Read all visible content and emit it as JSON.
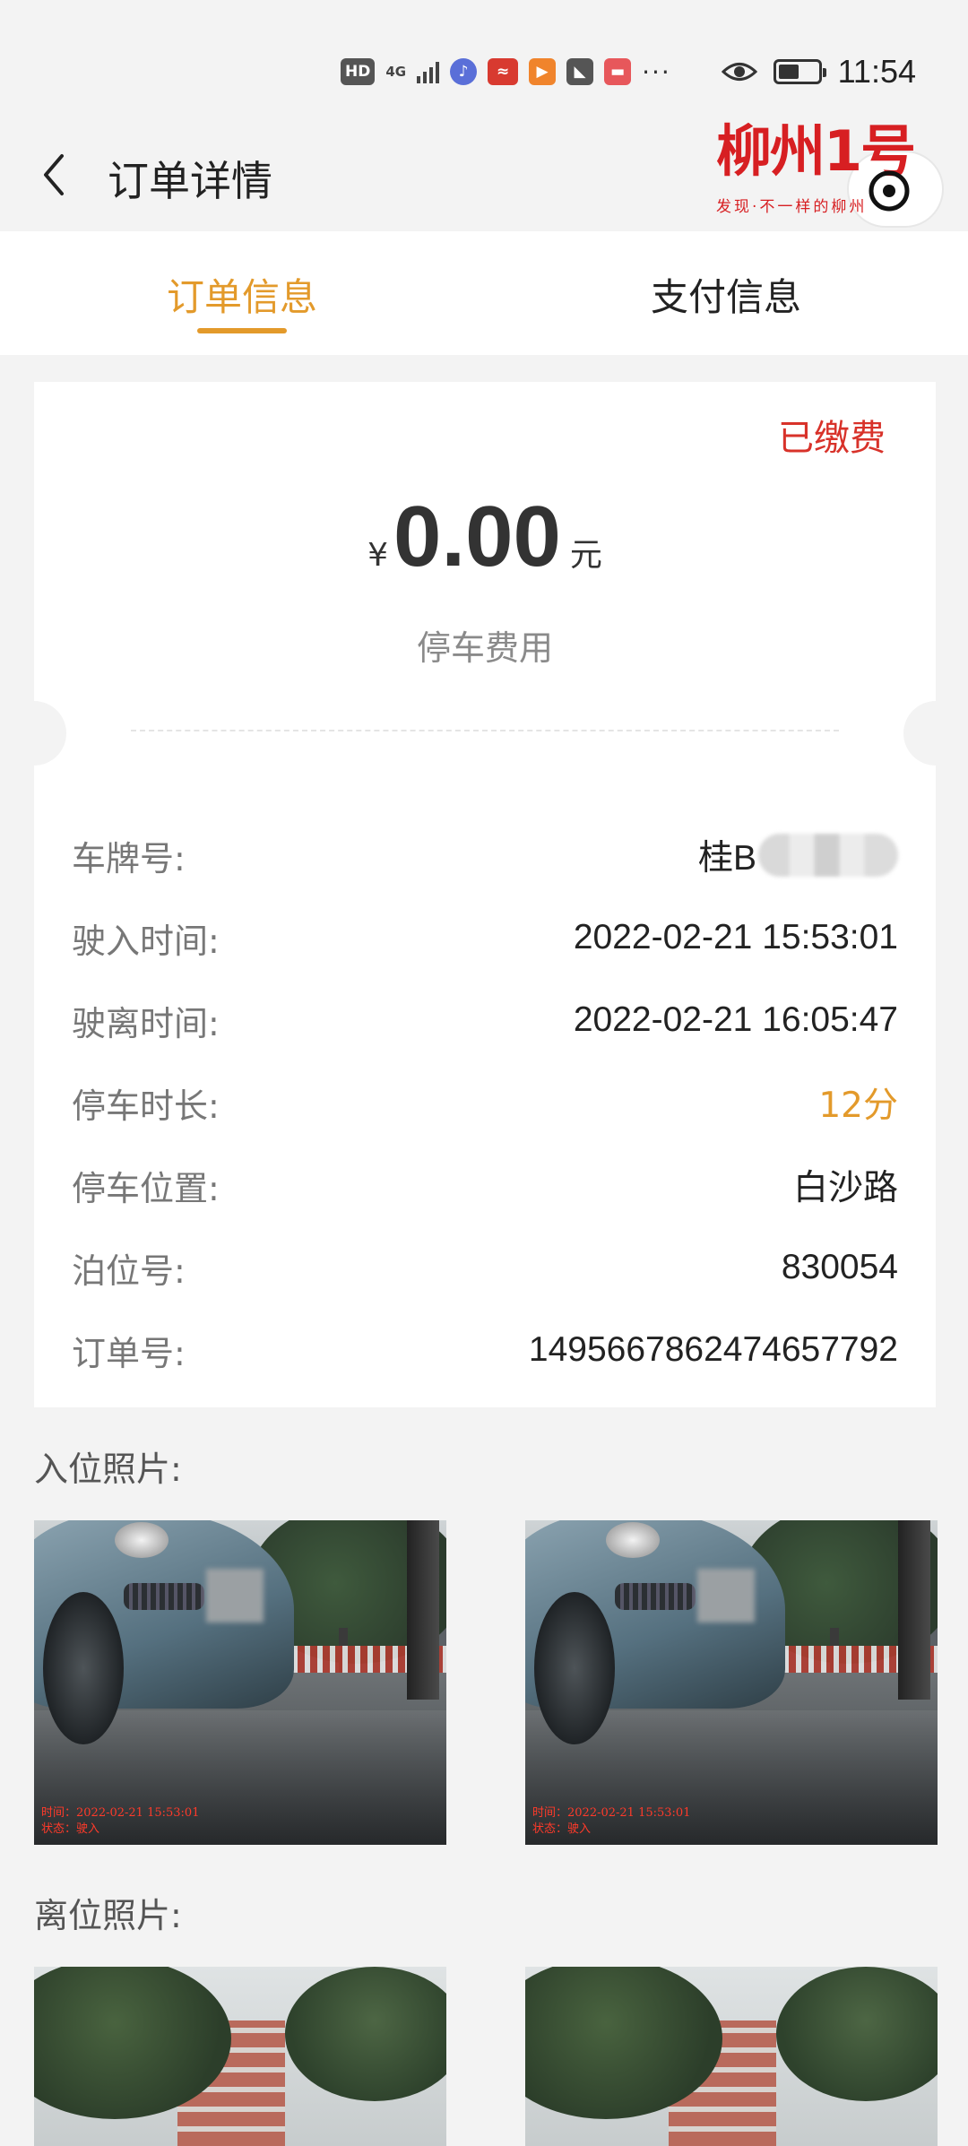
{
  "status_bar": {
    "hd": "HD",
    "network": "4G",
    "time": "11:54",
    "icons": [
      "hd-icon",
      "signal-icon",
      "music-icon",
      "app-icon",
      "video-icon",
      "app-icon",
      "app-icon",
      "more-icon",
      "eye-icon",
      "battery-icon"
    ]
  },
  "nav": {
    "title": "订单详情",
    "logo_text": "柳州1号",
    "logo_subtitle": "发现·不一样的柳州"
  },
  "tabs": [
    {
      "label": "订单信息",
      "active": true
    },
    {
      "label": "支付信息",
      "active": false
    }
  ],
  "colors": {
    "accent": "#e39a2b",
    "paid": "#d8322a",
    "background": "#f3f3f3"
  },
  "order": {
    "status": "已缴费",
    "currency": "¥",
    "amount": "0.00",
    "unit": "元",
    "fee_label": "停车费用",
    "fields": [
      {
        "label": "车牌号:",
        "value": "桂B"
      },
      {
        "label": "驶入时间:",
        "value": "2022-02-21 15:53:01"
      },
      {
        "label": "驶离时间:",
        "value": "2022-02-21 16:05:47"
      },
      {
        "label": "停车时长:",
        "value": "12分"
      },
      {
        "label": "停车位置:",
        "value": "白沙路"
      },
      {
        "label": "泊位号:",
        "value": "830054"
      },
      {
        "label": "订单号:",
        "value": "1495667862474657792"
      }
    ]
  },
  "photos": {
    "entry_title": "入位照片:",
    "exit_title": "离位照片:",
    "entry_stamp_time": "时间：2022-02-21 15:53:01",
    "entry_stamp_state": "状态：驶入"
  }
}
